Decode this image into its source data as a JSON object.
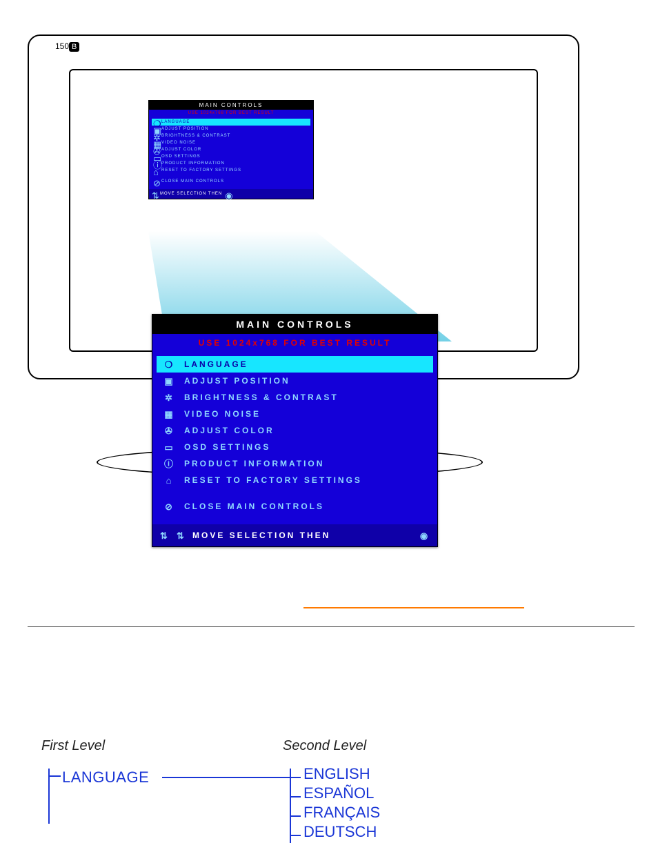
{
  "monitor": {
    "model_prefix": "150",
    "model_badge": "B"
  },
  "osd": {
    "title": "MAIN CONTROLS",
    "subtitle": "USE 1024x768 FOR BEST RESULT",
    "items": [
      {
        "icon": "globe-icon",
        "label": "LANGUAGE",
        "highlight": true
      },
      {
        "icon": "position-icon",
        "label": "ADJUST POSITION",
        "highlight": false
      },
      {
        "icon": "sun-icon",
        "label": "BRIGHTNESS & CONTRAST",
        "highlight": false
      },
      {
        "icon": "grid-icon",
        "label": "VIDEO NOISE",
        "highlight": false
      },
      {
        "icon": "palette-icon",
        "label": "ADJUST COLOR",
        "highlight": false
      },
      {
        "icon": "monitor-icon",
        "label": "OSD SETTINGS",
        "highlight": false
      },
      {
        "icon": "info-icon",
        "label": "PRODUCT INFORMATION",
        "highlight": false
      },
      {
        "icon": "factory-icon",
        "label": "RESET TO FACTORY SETTINGS",
        "highlight": false
      }
    ],
    "close_label": "CLOSE MAIN CONTROLS",
    "footer_label": "MOVE SELECTION THEN"
  },
  "tree": {
    "level1_header": "First Level",
    "level2_header": "Second Level",
    "level1": "LANGUAGE",
    "level2": [
      "ENGLISH",
      "ESPAÑOL",
      "FRANÇAIS",
      "DEUTSCH"
    ]
  },
  "glyphs": {
    "globe-icon": "❍",
    "position-icon": "▣",
    "sun-icon": "✲",
    "grid-icon": "▦",
    "palette-icon": "✇",
    "monitor-icon": "▭",
    "info-icon": "ⓘ",
    "factory-icon": "⌂",
    "close-icon": "⊘",
    "updown-icon": "⇅",
    "ok-icon": "◉"
  }
}
